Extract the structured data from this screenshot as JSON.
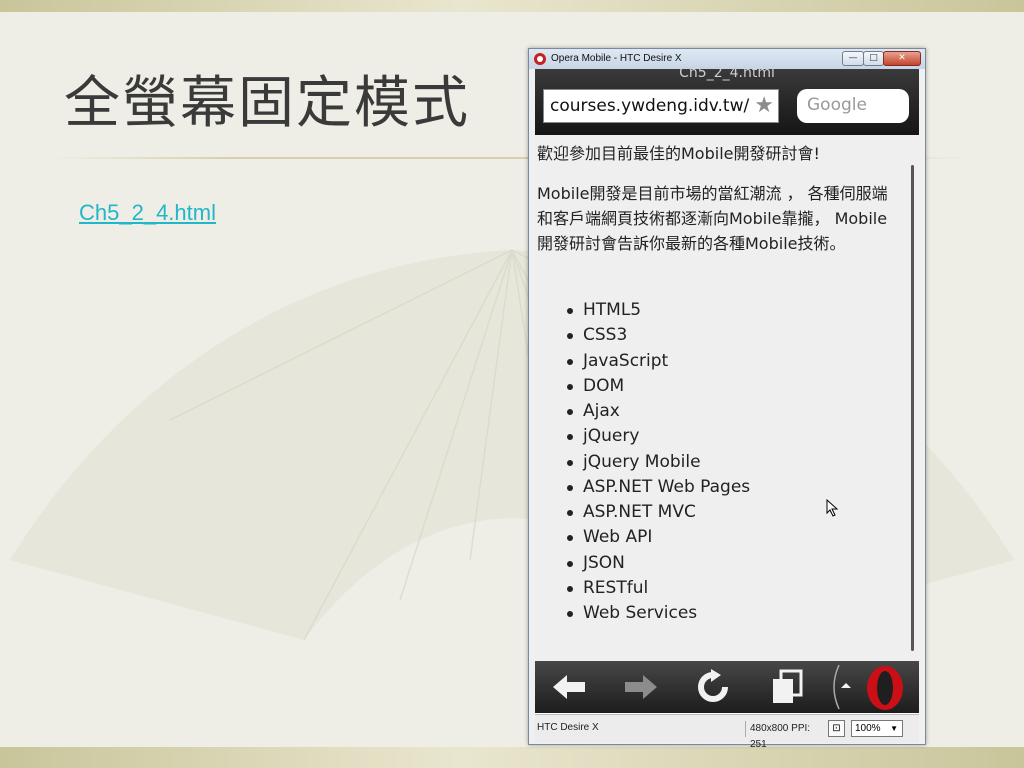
{
  "slide": {
    "title": "全螢幕固定模式",
    "link_text": "Ch5_2_4.html"
  },
  "emulator": {
    "window_title": "Opera Mobile - HTC Desire X",
    "window_buttons": {
      "min": "—",
      "max": "□",
      "close": "✕"
    },
    "page_title": "Ch5_2_4.html",
    "address": "courses.ywdeng.idv.tw/",
    "search_placeholder": "Google",
    "content": {
      "heading": "歡迎參加目前最佳的Mobile開發研討會!",
      "paragraph": "Mobile開發是目前市場的當紅潮流 ， 各種伺服端和客戶端網頁技術都逐漸向Mobile靠攏， Mobile開發研討會告訴你最新的各種Mobile技術。",
      "list": [
        "HTML5",
        "CSS3",
        "JavaScript",
        "DOM",
        "Ajax",
        "jQuery",
        "jQuery Mobile",
        "ASP.NET Web Pages",
        "ASP.NET MVC",
        "Web API",
        "JSON",
        "RESTful",
        "Web Services"
      ]
    },
    "toolbar_icons": [
      "back-icon",
      "forward-icon",
      "reload-icon",
      "tabs-icon",
      "opera-logo-icon"
    ],
    "status": {
      "device": "HTC Desire X",
      "resolution": "480x800",
      "ppi": "PPI: 251",
      "zoom": "100%"
    }
  },
  "colors": {
    "link": "#22b6c9",
    "opera_red": "#cc0f16",
    "toolbar": "#2a2a2a"
  }
}
